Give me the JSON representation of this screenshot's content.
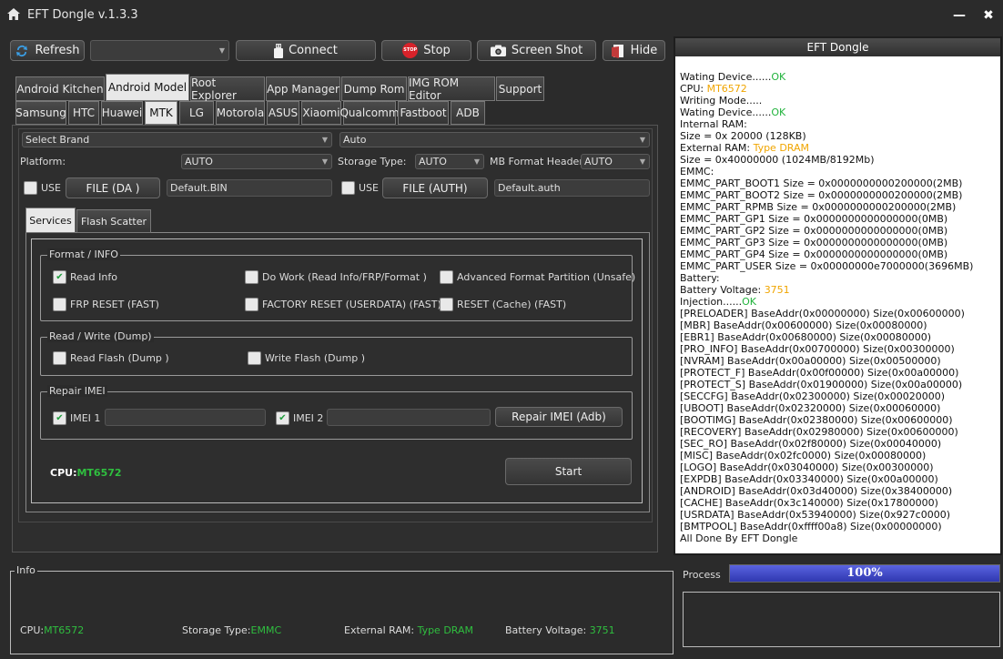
{
  "window": {
    "title": "EFT Dongle  v.1.3.3",
    "minimize": "—",
    "close": "✖"
  },
  "toolbar": {
    "refresh": "Refresh",
    "device_combo": "",
    "connect": "Connect",
    "stop": "Stop",
    "stop_badge": "STOP",
    "screenshot": "Screen Shot",
    "hide": "Hide"
  },
  "main_tabs": [
    {
      "label": "Android Kitchen",
      "active": false
    },
    {
      "label": "Android Model",
      "active": true
    },
    {
      "label": "Root Explorer",
      "active": false
    },
    {
      "label": "App Manager",
      "active": false
    },
    {
      "label": "Dump Rom",
      "active": false
    },
    {
      "label": "IMG ROM Editor",
      "active": false
    },
    {
      "label": "Support",
      "active": false
    }
  ],
  "brand_tabs": [
    {
      "label": "Samsung",
      "active": false
    },
    {
      "label": "HTC",
      "active": false
    },
    {
      "label": "Huawei",
      "active": false
    },
    {
      "label": "MTK",
      "active": true
    },
    {
      "label": "LG",
      "active": false
    },
    {
      "label": "Motorola",
      "active": false
    },
    {
      "label": "ASUS",
      "active": false
    },
    {
      "label": "Xiaomi",
      "active": false
    },
    {
      "label": "Qualcomm",
      "active": false
    },
    {
      "label": "Fastboot",
      "active": false
    },
    {
      "label": "ADB",
      "active": false
    }
  ],
  "mtk": {
    "brand_select": "Select Brand",
    "model_select": "Auto",
    "platform_label": "Platform:",
    "platform_value": "AUTO",
    "storage_label": "Storage Type:",
    "storage_value": "AUTO",
    "mbformat_label": "MB Format Header",
    "mbformat_value": "AUTO",
    "use_label_1": "USE",
    "file_da": "FILE (DA )",
    "da_value": "Default.BIN",
    "use_label_2": "USE",
    "file_auth": "FILE (AUTH)",
    "auth_value": "Default.auth"
  },
  "sub_tabs": [
    {
      "label": "Services",
      "active": true
    },
    {
      "label": "Flash Scatter",
      "active": false
    }
  ],
  "format_group": {
    "title": "Format / INFO",
    "options": [
      {
        "label": "Read Info",
        "checked": true
      },
      {
        "label": "Do Work (Read Info/FRP/Format )",
        "checked": false
      },
      {
        "label": "Advanced Format Partition (Unsafe)",
        "checked": false
      },
      {
        "label": "FRP RESET (FAST)",
        "checked": false
      },
      {
        "label": "FACTORY RESET (USERDATA) (FAST)",
        "checked": false
      },
      {
        "label": "RESET (Cache) (FAST)",
        "checked": false
      }
    ]
  },
  "rw_group": {
    "title": "Read / Write (Dump)",
    "read_flash": "Read Flash (Dump )",
    "write_flash": "Write Flash (Dump )"
  },
  "imei_group": {
    "title": "Repair IMEI",
    "imei1_label": "IMEI 1",
    "imei1_value": "",
    "imei2_label": "IMEI 2",
    "imei2_value": "",
    "repair_button": "Repair IMEI (Adb)"
  },
  "cpu_status": {
    "label": "CPU:",
    "value": "MT6572"
  },
  "start_button": "Start",
  "log": {
    "title": "EFT Dongle",
    "lines": [
      [
        {
          "t": "Wating Device......"
        },
        {
          "t": "OK",
          "c": "green"
        }
      ],
      [
        {
          "t": "CPU: "
        },
        {
          "t": "MT6572",
          "c": "orange"
        }
      ],
      [
        {
          "t": "Writing Mode....."
        }
      ],
      [
        {
          "t": "Wating Device......"
        },
        {
          "t": "OK",
          "c": "green"
        }
      ],
      [
        {
          "t": "Internal RAM:"
        }
      ],
      [
        {
          "t": "Size = 0x 20000 (128KB)"
        }
      ],
      [
        {
          "t": "External RAM: "
        },
        {
          "t": "Type DRAM",
          "c": "orange"
        }
      ],
      [
        {
          "t": "Size = 0x40000000 (1024MB/8192Mb)"
        }
      ],
      [
        {
          "t": "EMMC:"
        }
      ],
      [
        {
          "t": "EMMC_PART_BOOT1 Size = 0x0000000000200000(2MB)"
        }
      ],
      [
        {
          "t": "EMMC_PART_BOOT2 Size = 0x0000000000200000(2MB)"
        }
      ],
      [
        {
          "t": "EMMC_PART_RPMB Size = 0x0000000000200000(2MB)"
        }
      ],
      [
        {
          "t": "EMMC_PART_GP1 Size = 0x0000000000000000(0MB)"
        }
      ],
      [
        {
          "t": "EMMC_PART_GP2 Size = 0x0000000000000000(0MB)"
        }
      ],
      [
        {
          "t": "EMMC_PART_GP3 Size = 0x0000000000000000(0MB)"
        }
      ],
      [
        {
          "t": "EMMC_PART_GP4 Size = 0x0000000000000000(0MB)"
        }
      ],
      [
        {
          "t": "EMMC_PART_USER Size = 0x00000000e7000000(3696MB)"
        }
      ],
      [
        {
          "t": "Battery:"
        }
      ],
      [
        {
          "t": "Battery Voltage: "
        },
        {
          "t": "3751",
          "c": "orange"
        }
      ],
      [
        {
          "t": "Injection......"
        },
        {
          "t": "OK",
          "c": "green"
        }
      ],
      [
        {
          "t": "[PRELOADER] BaseAddr(0x00000000) Size(0x00600000)"
        }
      ],
      [
        {
          "t": "[MBR] BaseAddr(0x00600000) Size(0x00080000)"
        }
      ],
      [
        {
          "t": "[EBR1] BaseAddr(0x00680000) Size(0x00080000)"
        }
      ],
      [
        {
          "t": "[PRO_INFO] BaseAddr(0x00700000) Size(0x00300000)"
        }
      ],
      [
        {
          "t": "[NVRAM] BaseAddr(0x00a00000) Size(0x00500000)"
        }
      ],
      [
        {
          "t": "[PROTECT_F] BaseAddr(0x00f00000) Size(0x00a00000)"
        }
      ],
      [
        {
          "t": "[PROTECT_S] BaseAddr(0x01900000) Size(0x00a00000)"
        }
      ],
      [
        {
          "t": "[SECCFG] BaseAddr(0x02300000) Size(0x00020000)"
        }
      ],
      [
        {
          "t": "[UBOOT] BaseAddr(0x02320000) Size(0x00060000)"
        }
      ],
      [
        {
          "t": "[BOOTIMG] BaseAddr(0x02380000) Size(0x00600000)"
        }
      ],
      [
        {
          "t": "[RECOVERY] BaseAddr(0x02980000) Size(0x00600000)"
        }
      ],
      [
        {
          "t": "[SEC_RO] BaseAddr(0x02f80000) Size(0x00040000)"
        }
      ],
      [
        {
          "t": "[MISC] BaseAddr(0x02fc0000) Size(0x00080000)"
        }
      ],
      [
        {
          "t": "[LOGO] BaseAddr(0x03040000) Size(0x00300000)"
        }
      ],
      [
        {
          "t": "[EXPDB] BaseAddr(0x03340000) Size(0x00a00000)"
        }
      ],
      [
        {
          "t": "[ANDROID] BaseAddr(0x03d40000) Size(0x38400000)"
        }
      ],
      [
        {
          "t": "[CACHE] BaseAddr(0x3c140000) Size(0x17800000)"
        }
      ],
      [
        {
          "t": "[USRDATA] BaseAddr(0x53940000) Size(0x927c0000)"
        }
      ],
      [
        {
          "t": "[BMTPOOL] BaseAddr(0xffff00a8) Size(0x00000000)"
        }
      ],
      [
        {
          "t": "All Done By EFT Dongle"
        }
      ]
    ]
  },
  "info_panel": {
    "title": "Info",
    "cpu_label": "CPU:",
    "cpu_value": "MT6572",
    "storage_label": "Storage Type:",
    "storage_value": "EMMC",
    "ram_label": "External RAM: ",
    "ram_value": "Type DRAM",
    "battery_label": "Battery Voltage: ",
    "battery_value": "3751"
  },
  "process": {
    "label": "Process",
    "percent_text": "100%",
    "progress": 1.0
  },
  "colors": {
    "accent_green": "#21b33c",
    "accent_orange": "#f0a500",
    "progress_blue": "#3a46c8",
    "background": "#2b2b2b"
  },
  "icons": {
    "app": "home-icon",
    "refresh": "refresh-icon",
    "connect": "usb-icon",
    "stop": "stop-sign-icon",
    "screenshot": "camera-icon",
    "hide": "hide-icon"
  }
}
